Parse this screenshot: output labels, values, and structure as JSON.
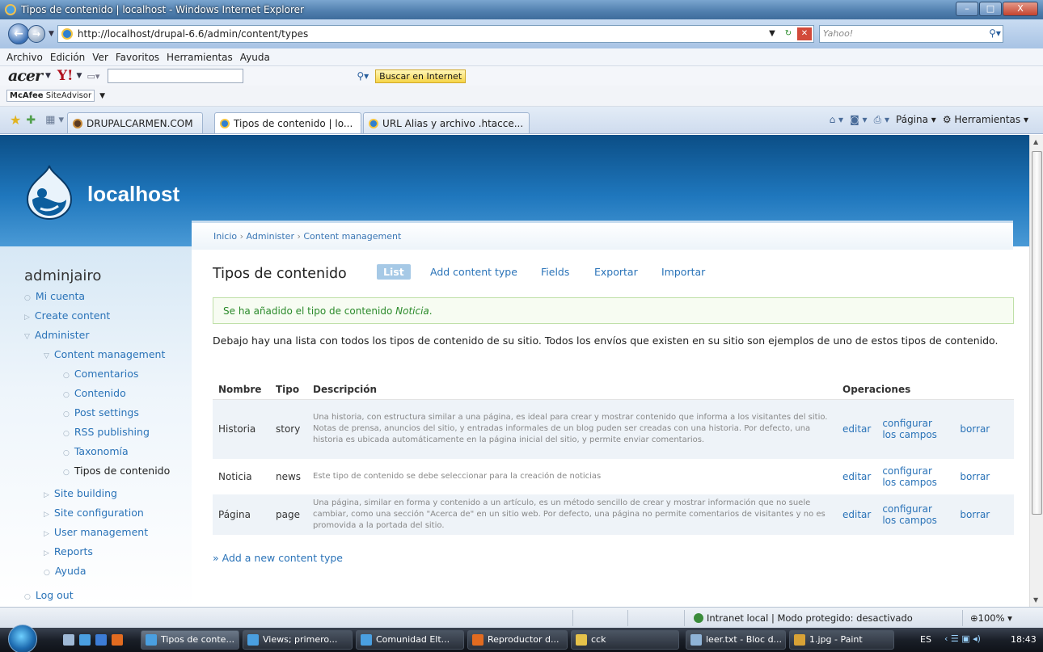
{
  "window": {
    "title": "Tipos de contenido | localhost - Windows Internet Explorer",
    "min_glyph": "–",
    "max_glyph": "□",
    "close_glyph": "X"
  },
  "address_bar": {
    "url": "http://localhost/drupal-6.6/admin/content/types",
    "search_placeholder": "Yahoo!"
  },
  "menu": [
    "Archivo",
    "Edición",
    "Ver",
    "Favoritos",
    "Herramientas",
    "Ayuda"
  ],
  "yahoo_toolbar": {
    "brand": "acer",
    "yahoo": "Y!",
    "search_button": "Buscar en Internet"
  },
  "mcafee": {
    "label": "McAfee",
    "sub": "SiteAdvisor"
  },
  "tabs": [
    {
      "label": "DRUPALCARMEN.COM"
    },
    {
      "label": "Tipos de contenido | lo...",
      "close": "✕"
    },
    {
      "label": "URL Alias y archivo .htacce..."
    }
  ],
  "ie_tools": {
    "page": "Página",
    "tools": "Herramientas"
  },
  "site": {
    "name": "localhost",
    "colors": {
      "header": "#1f77bd",
      "link": "#2a73b8"
    }
  },
  "breadcrumb": [
    "Inicio",
    "Administer",
    "Content management"
  ],
  "sidebar": {
    "user": "adminjairo",
    "items": [
      {
        "label": "Mi cuenta"
      },
      {
        "label": "Create content"
      },
      {
        "label": "Administer"
      },
      {
        "label": "Content management"
      },
      {
        "label": "Comentarios"
      },
      {
        "label": "Contenido"
      },
      {
        "label": "Post settings"
      },
      {
        "label": "RSS publishing"
      },
      {
        "label": "Taxonomía"
      },
      {
        "label": "Tipos de contenido"
      },
      {
        "label": "Site building"
      },
      {
        "label": "Site configuration"
      },
      {
        "label": "User management"
      },
      {
        "label": "Reports"
      },
      {
        "label": "Ayuda"
      },
      {
        "label": "Log out"
      }
    ]
  },
  "content": {
    "title": "Tipos de contenido",
    "tabs": [
      "List",
      "Add content type",
      "Fields",
      "Exportar",
      "Importar"
    ],
    "message_prefix": "Se ha añadido el tipo de contenido ",
    "message_type": "Noticia",
    "message_suffix": ".",
    "intro": "Debajo hay una lista con todos los tipos de contenido de su sitio. Todos los envíos que existen en su sitio son ejemplos de uno de estos tipos de contenido.",
    "table": {
      "headers": [
        "Nombre",
        "Tipo",
        "Descripción",
        "Operaciones"
      ],
      "rows": [
        {
          "name": "Historia",
          "type": "story",
          "desc": "Una historia, con estructura similar a una página, es ideal para crear y mostrar contenido que informa a los visitantes del sitio. Notas de prensa, anuncios del sitio, y entradas informales de un blog puden ser creadas con una historia. Por defecto, una historia es ubicada automáticamente en la página inicial del sitio, y permite enviar comentarios.",
          "edit": "editar",
          "fields": "configurar los campos",
          "delete": "borrar"
        },
        {
          "name": "Noticia",
          "type": "news",
          "desc": "Este tipo de contenido se debe seleccionar para la creación de noticias",
          "edit": "editar",
          "fields": "configurar los campos",
          "delete": "borrar"
        },
        {
          "name": "Página",
          "type": "page",
          "desc": "Una página, similar en forma y contenido a un artículo, es un método sencillo de crear y mostrar información que no suele cambiar, como una sección \"Acerca de\" en un sitio web. Por defecto, una página no permite comentarios de visitantes y no es promovida a la portada del sitio.",
          "edit": "editar",
          "fields": "configurar los campos",
          "delete": "borrar"
        }
      ]
    },
    "add_link": "» Add a new content type"
  },
  "statusbar": {
    "zone": "Intranet local | Modo protegido: desactivado",
    "zoom": "100%"
  },
  "taskbar": {
    "items": [
      "Tipos de conte...",
      "Views; primero...",
      "Comunidad Elt...",
      "Reproductor d...",
      "cck",
      "leer.txt - Bloc d...",
      "1.jpg - Paint"
    ],
    "lang": "ES",
    "clock": "18:43"
  }
}
